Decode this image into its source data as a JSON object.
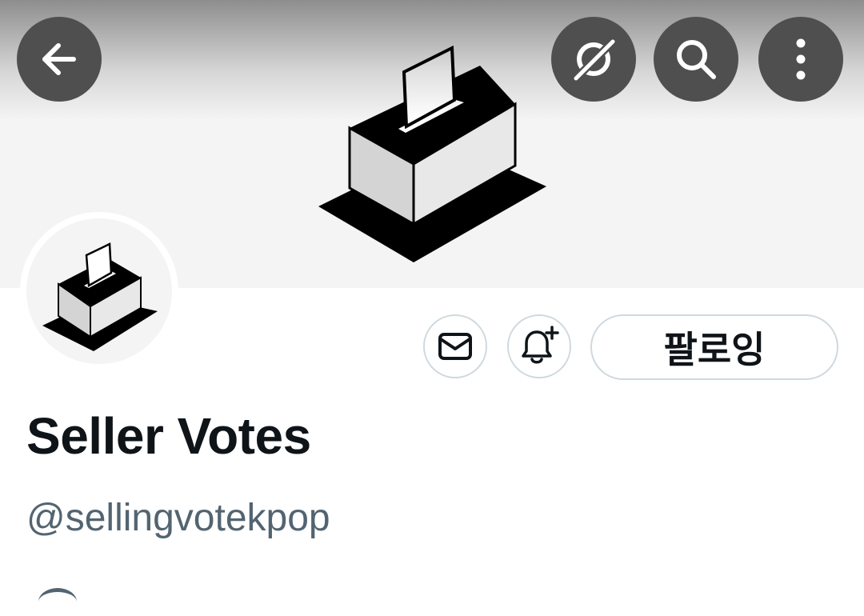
{
  "header": {
    "back_icon": "arrow-left-icon",
    "actions": [
      "grok-logo-icon",
      "search-icon",
      "more-vertical-icon"
    ]
  },
  "banner": {
    "image": "ballot-box-illustration"
  },
  "profile": {
    "avatar_image": "ballot-box-illustration",
    "display_name": "Seller Votes",
    "handle": "@sellingvotekpop"
  },
  "buttons": {
    "message_icon": "envelope-icon",
    "notify_icon": "bell-plus-icon",
    "follow_label": "팔로잉"
  },
  "colors": {
    "primary_text": "#0f1419",
    "secondary_text": "#536471",
    "border": "#cfd9de",
    "header_button_bg": "#4f4f4f"
  }
}
